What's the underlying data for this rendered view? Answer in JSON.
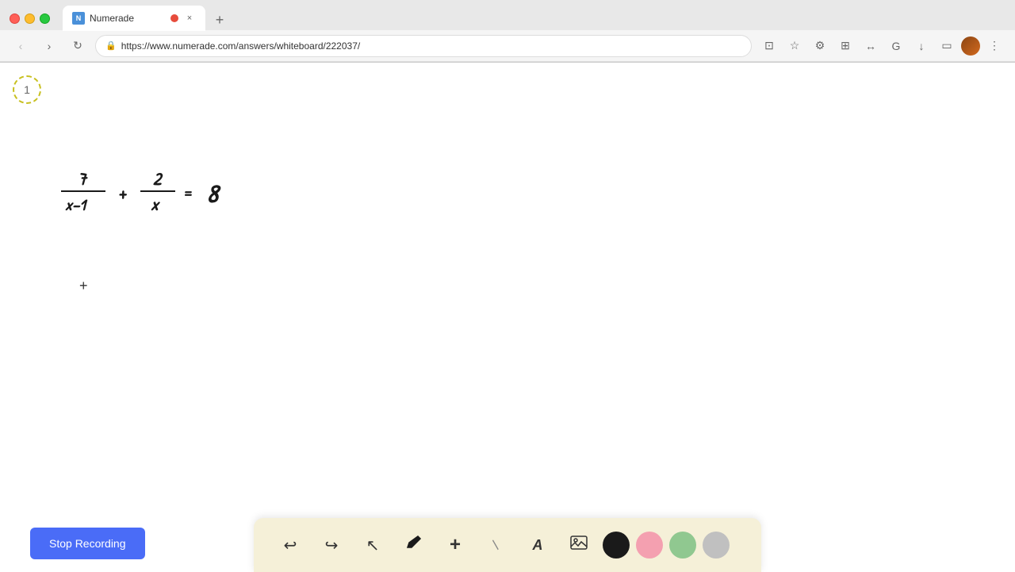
{
  "browser": {
    "tab_title": "Numerade",
    "tab_favicon_text": "N",
    "url": "https://www.numerade.com/answers/whiteboard/222037/",
    "new_tab_label": "+"
  },
  "page_indicator": {
    "number": "1"
  },
  "toolbar": {
    "undo_label": "↩",
    "redo_label": "↪",
    "cursor_label": "↖",
    "pen_label": "✏",
    "plus_label": "+",
    "eraser_label": "/",
    "text_label": "A",
    "image_label": "🖼"
  },
  "stop_recording": {
    "label": "Stop Recording"
  },
  "colors": {
    "black": "#1a1a1a",
    "pink": "#f4a0b0",
    "green": "#90c890",
    "gray": "#c0c0c0"
  }
}
